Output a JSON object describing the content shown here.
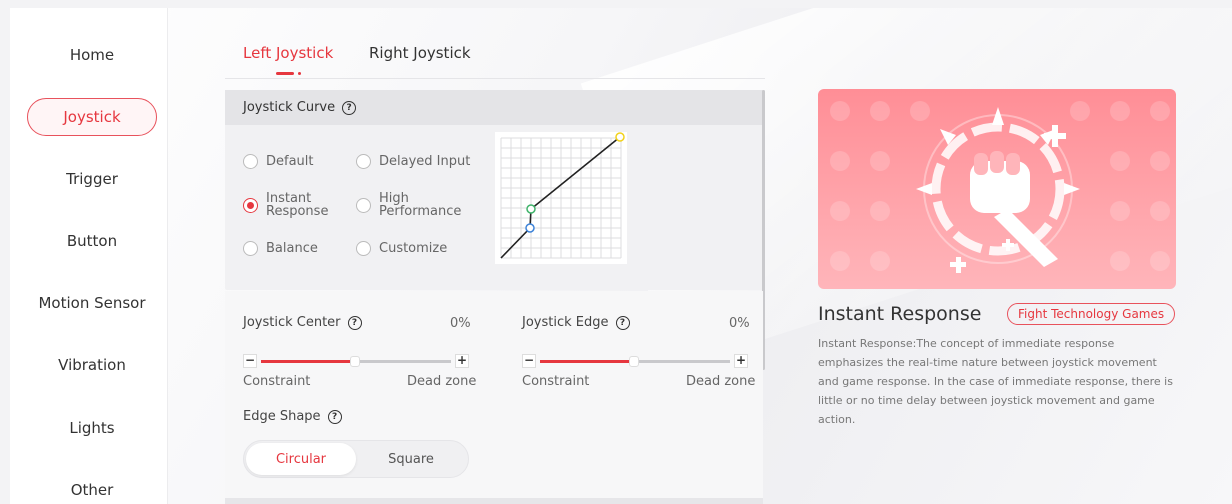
{
  "sidebar": {
    "items": [
      {
        "label": "Home"
      },
      {
        "label": "Joystick"
      },
      {
        "label": "Trigger"
      },
      {
        "label": "Button"
      },
      {
        "label": "Motion Sensor"
      },
      {
        "label": "Vibration"
      },
      {
        "label": "Lights"
      },
      {
        "label": "Other"
      }
    ],
    "active_index": 1
  },
  "tabs": [
    {
      "label": "Left Joystick"
    },
    {
      "label": "Right Joystick"
    }
  ],
  "curve_panel": {
    "title": "Joystick Curve",
    "options": [
      {
        "label": "Default",
        "checked": false
      },
      {
        "label": "Delayed Input",
        "checked": false
      },
      {
        "label": "Instant Response",
        "line1": "Instant",
        "line2": "Response",
        "checked": true
      },
      {
        "label": "High Performance",
        "line1": "High",
        "line2": "Performance",
        "checked": false
      },
      {
        "label": "Balance",
        "checked": false
      },
      {
        "label": "Customize",
        "checked": false
      }
    ]
  },
  "joystick_center": {
    "label": "Joystick Center",
    "value": "0%",
    "fill_fraction": 0.47,
    "min_caption": "Constraint",
    "max_caption": "Dead zone",
    "minus": "−",
    "plus": "+"
  },
  "joystick_edge": {
    "label": "Joystick Edge",
    "value": "0%",
    "fill_fraction": 0.47,
    "min_caption": "Constraint",
    "max_caption": "Dead zone",
    "minus": "−",
    "plus": "+"
  },
  "edge_shape": {
    "label": "Edge Shape",
    "options": [
      "Circular",
      "Square"
    ],
    "selected": "Circular"
  },
  "info": {
    "title": "Instant Response",
    "badge": "Fight Technology Games",
    "description": "Instant Response:The concept of immediate response emphasizes the real-time nature between joystick movement and game response. In the case of immediate response, there is little or no time delay between joystick movement and game action."
  },
  "colors": {
    "accent": "#e6373f",
    "hero_top": "#ff8e96",
    "hero_bottom": "#ffb5ba",
    "point_end": "#f2d21b",
    "point_mid": "#3fb36a",
    "point_start": "#3c82d8"
  }
}
